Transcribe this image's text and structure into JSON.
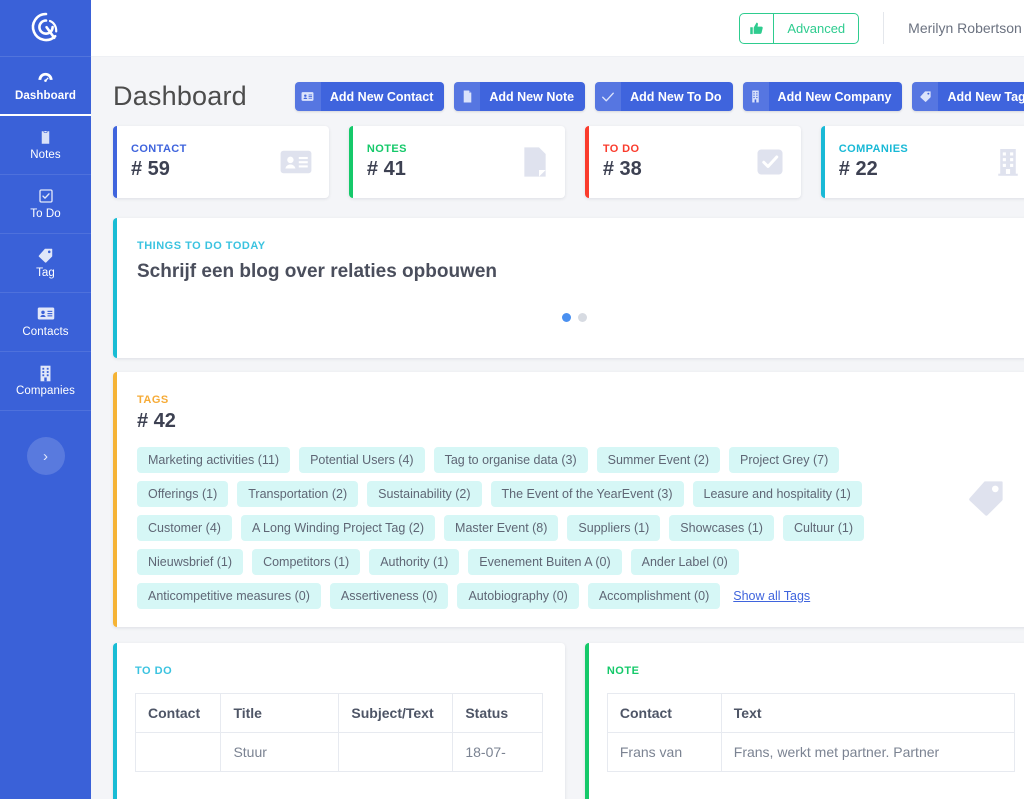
{
  "sidebar": {
    "logo_name": "app-logo",
    "items": [
      {
        "label": "Dashboard",
        "icon": "dashboard-icon",
        "active": true
      },
      {
        "label": "Notes",
        "icon": "note-icon",
        "active": false
      },
      {
        "label": "To Do",
        "icon": "checkbox-icon",
        "active": false
      },
      {
        "label": "Tag",
        "icon": "tag-icon",
        "active": false
      },
      {
        "label": "Contacts",
        "icon": "contact-card-icon",
        "active": false
      },
      {
        "label": "Companies",
        "icon": "building-icon",
        "active": false
      }
    ],
    "collapse_glyph": "›"
  },
  "topbar": {
    "advanced_label": "Advanced",
    "thumb_icon": "thumbs-up-icon",
    "user_name": "Merilyn Robertson",
    "caret_glyph": "▼"
  },
  "header": {
    "title": "Dashboard",
    "actions": [
      {
        "label": "Add New Contact",
        "icon": "contact-card-icon"
      },
      {
        "label": "Add New Note",
        "icon": "note-icon"
      },
      {
        "label": "Add New To Do",
        "icon": "check-icon"
      },
      {
        "label": "Add New Company",
        "icon": "building-icon"
      },
      {
        "label": "Add New Tag",
        "icon": "tag-icon"
      }
    ]
  },
  "stats": [
    {
      "label": "CONTACT",
      "value": "# 59",
      "color": "#3f64dd",
      "icon": "contact-card-icon"
    },
    {
      "label": "NOTES",
      "value": "# 41",
      "color": "#15c96a",
      "icon": "note-icon"
    },
    {
      "label": "TO DO",
      "value": "# 38",
      "color": "#fa3c2d",
      "icon": "checkbox-icon"
    },
    {
      "label": "COMPANIES",
      "value": "# 22",
      "color": "#19b9d6",
      "icon": "building-icon"
    }
  ],
  "things_to_do_today": {
    "kicker": "THINGS TO DO TODAY",
    "kicker_color": "#3bc3e0",
    "bar_color": "#18bcd4",
    "title": "Schrijf een blog over relaties opbouwen",
    "dots_total": 2,
    "dots_active_index": 0
  },
  "tags_panel": {
    "kicker": "TAGS",
    "kicker_color": "#f6ab37",
    "bar_color": "#f5b335",
    "count": "# 42",
    "watermark_icon": "tag-icon",
    "show_all_label": "Show all Tags",
    "rows": [
      [
        "Marketing activities (11)",
        "Potential Users (4)",
        "Tag to organise data (3)",
        "Summer Event (2)",
        "Project Grey (7)"
      ],
      [
        "Offerings (1)",
        "Transportation (2)",
        "Sustainability (2)",
        "The Event of the YearEvent (3)",
        "Leasure and hospitality (1)"
      ],
      [
        "Customer (4)",
        "A Long Winding Project Tag (2)",
        "Master Event (8)",
        "Suppliers (1)",
        "Showcases (1)",
        "Cultuur (1)"
      ],
      [
        "Nieuwsbrief (1)",
        "Competitors (1)",
        "Authority (1)",
        "Evenement Buiten A (0)",
        "Ander Label (0)"
      ],
      [
        "Anticompetitive measures (0)",
        "Assertiveness (0)",
        "Autobiography (0)",
        "Accomplishment (0)"
      ]
    ]
  },
  "todo_panel": {
    "kicker": "TO DO",
    "kicker_color": "#3bc3e0",
    "bar_color": "#18bcd4",
    "columns": [
      "Contact",
      "Title",
      "Subject/Text",
      "Status"
    ],
    "rows": [
      {
        "contact": "",
        "title": "Stuur",
        "subject": "",
        "status": "18-07-"
      }
    ]
  },
  "note_panel": {
    "kicker": "NOTE",
    "kicker_color": "#15c96a",
    "bar_color": "#15c96a",
    "columns": [
      "Contact",
      "Text"
    ],
    "rows": [
      {
        "contact": "Frans van",
        "text": "Frans, werkt met partner. Partner"
      }
    ]
  }
}
